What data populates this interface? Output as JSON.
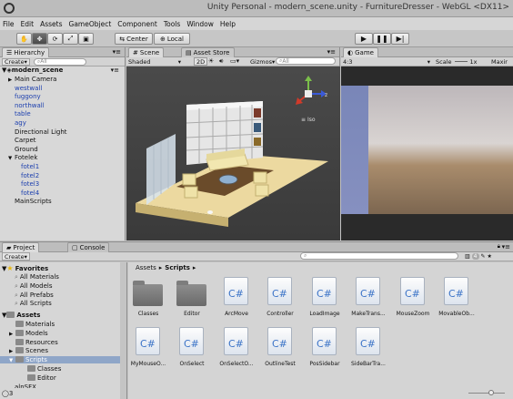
{
  "window": {
    "title": "Unity Personal - modern_scene.unity - FurnitureDresser - WebGL <DX11>"
  },
  "menu": [
    "File",
    "Edit",
    "Assets",
    "GameObject",
    "Component",
    "Tools",
    "Window",
    "Help"
  ],
  "toolbar": {
    "center_label": "Center",
    "local_label": "Local"
  },
  "hierarchy": {
    "tab": "Hierarchy",
    "create_label": "Create",
    "search_placeholder": "All",
    "scene_name": "modern_scene",
    "items": [
      {
        "label": "Main Camera",
        "blue": false,
        "indent": 1,
        "arrow": "▶"
      },
      {
        "label": "westwall",
        "blue": true,
        "indent": 1,
        "arrow": ""
      },
      {
        "label": "fuggony",
        "blue": true,
        "indent": 1,
        "arrow": ""
      },
      {
        "label": "northwall",
        "blue": true,
        "indent": 1,
        "arrow": ""
      },
      {
        "label": "table",
        "blue": true,
        "indent": 1,
        "arrow": ""
      },
      {
        "label": "agy",
        "blue": true,
        "indent": 1,
        "arrow": ""
      },
      {
        "label": "Directional Light",
        "blue": false,
        "indent": 1,
        "arrow": ""
      },
      {
        "label": "Carpet",
        "blue": false,
        "indent": 1,
        "arrow": ""
      },
      {
        "label": "Ground",
        "blue": false,
        "indent": 1,
        "arrow": ""
      },
      {
        "label": "Fotelek",
        "blue": false,
        "indent": 1,
        "arrow": "▼"
      },
      {
        "label": "fotel1",
        "blue": true,
        "indent": 2,
        "arrow": ""
      },
      {
        "label": "fotel2",
        "blue": true,
        "indent": 2,
        "arrow": ""
      },
      {
        "label": "fotel3",
        "blue": true,
        "indent": 2,
        "arrow": ""
      },
      {
        "label": "fotel4",
        "blue": true,
        "indent": 2,
        "arrow": ""
      },
      {
        "label": "MainScripts",
        "blue": false,
        "indent": 1,
        "arrow": ""
      }
    ]
  },
  "scene": {
    "tab": "Scene",
    "asset_store_tab": "Asset Store",
    "shading": "Shaded",
    "mode_2d": "2D",
    "gizmos": "Gizmos",
    "search_placeholder": "All",
    "iso_label": "Iso"
  },
  "game": {
    "tab": "Game",
    "aspect": "4:3",
    "scale_label": "Scale",
    "scale_value": "1x",
    "maximize_label": "Maxir"
  },
  "project": {
    "tab": "Project",
    "console_tab": "Console",
    "create_label": "Create",
    "breadcrumb": [
      "Assets",
      "Scripts"
    ],
    "count_badge": "4",
    "favorites_label": "Favorites",
    "favorites": [
      "All Materials",
      "All Models",
      "All Prefabs",
      "All Scripts"
    ],
    "assets_label": "Assets",
    "assets": [
      "Materials",
      "Models",
      "Resources",
      "Scenes",
      "Scripts"
    ],
    "scripts_children": [
      "Classes",
      "Editor"
    ],
    "partial_item": "alnSFX",
    "bottom_number": "3",
    "files_row1": [
      {
        "name": "Classes",
        "kind": "folder"
      },
      {
        "name": "Editor",
        "kind": "folder"
      },
      {
        "name": "ArcMove",
        "kind": "script"
      },
      {
        "name": "Controller",
        "kind": "script"
      },
      {
        "name": "LoadImage",
        "kind": "script"
      },
      {
        "name": "MakeTrans...",
        "kind": "script"
      },
      {
        "name": "MouseZoom",
        "kind": "script"
      },
      {
        "name": "MovableOb...",
        "kind": "script"
      }
    ],
    "files_row2": [
      {
        "name": "MyMouseO...",
        "kind": "script"
      },
      {
        "name": "OnSelect",
        "kind": "script"
      },
      {
        "name": "OnSelectO...",
        "kind": "script"
      },
      {
        "name": "OutlineTest",
        "kind": "script"
      },
      {
        "name": "PosSidebar",
        "kind": "script"
      },
      {
        "name": "SideBarTra...",
        "kind": "script"
      }
    ],
    "script_glyph": "C#"
  }
}
